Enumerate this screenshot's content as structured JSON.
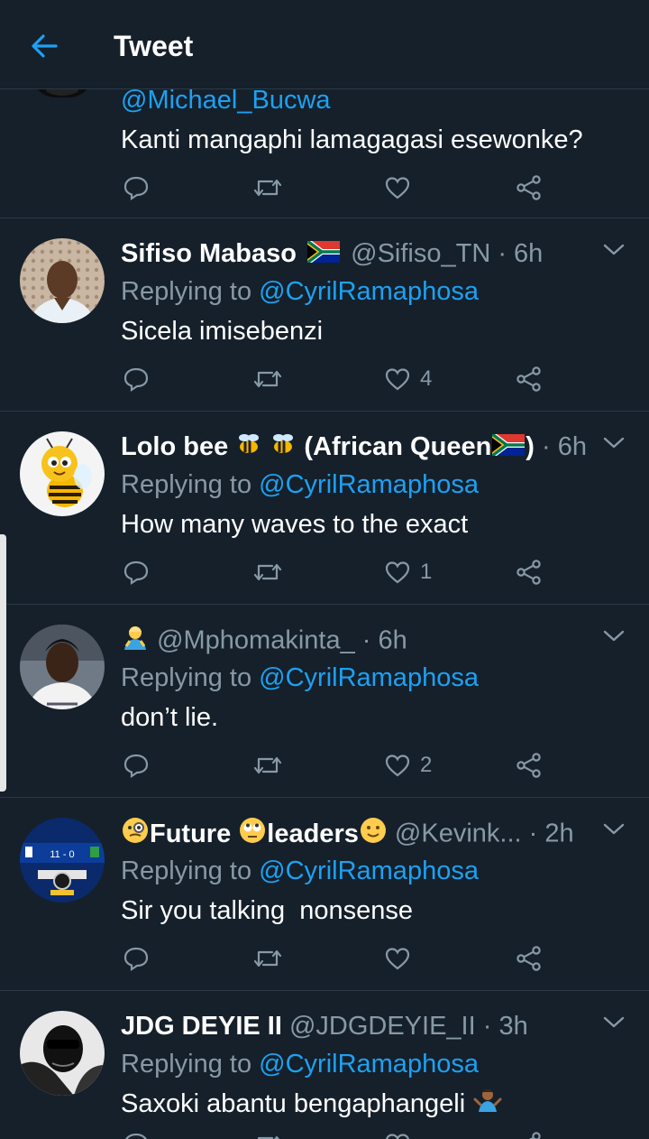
{
  "header": {
    "title": "Tweet"
  },
  "first_tweet": {
    "handle": "@Michael_Bucwa",
    "text": "Kanti mangaphi lamagagasi esewonke?"
  },
  "replying_prefix": "Replying to",
  "tweets": [
    {
      "display_name": "Sifiso Mabaso",
      "handle": "@Sifiso_TN",
      "time": "· 6h",
      "mention": "@CyrilRamaphosa",
      "text": "Sicela imisebenzi",
      "likes": "4"
    },
    {
      "display_name_a": "Lolo bee",
      "display_name_b": "(African Queen",
      "display_name_c": ")",
      "time": "· 6h",
      "mention": "@CyrilRamaphosa",
      "text": "How many waves to the exact",
      "likes": "1"
    },
    {
      "handle": "@Mphomakinta_",
      "time": "· 6h",
      "mention": "@CyrilRamaphosa",
      "text": "don’t lie.",
      "likes": "2"
    },
    {
      "display_name_a": "Future",
      "display_name_b": "leaders",
      "handle": "@Kevink...",
      "time": "· 2h",
      "mention": "@CyrilRamaphosa",
      "text": "Sir you talking  nonsense",
      "avatar_score": "11 - 0"
    },
    {
      "display_name": "JDG DEYIE II",
      "handle": "@JDGDEYIE_II",
      "time": "· 3h",
      "mention": "@CyrilRamaphosa",
      "text": "Saxoki abantu bengaphangeli"
    }
  ],
  "colors": {
    "background": "#15202b",
    "accent": "#1da1f2",
    "muted": "#8899a6",
    "divider": "#2b3945"
  },
  "icons": [
    "back-arrow-icon",
    "reply-icon",
    "retweet-icon",
    "like-icon",
    "share-icon",
    "chevron-down-icon"
  ]
}
